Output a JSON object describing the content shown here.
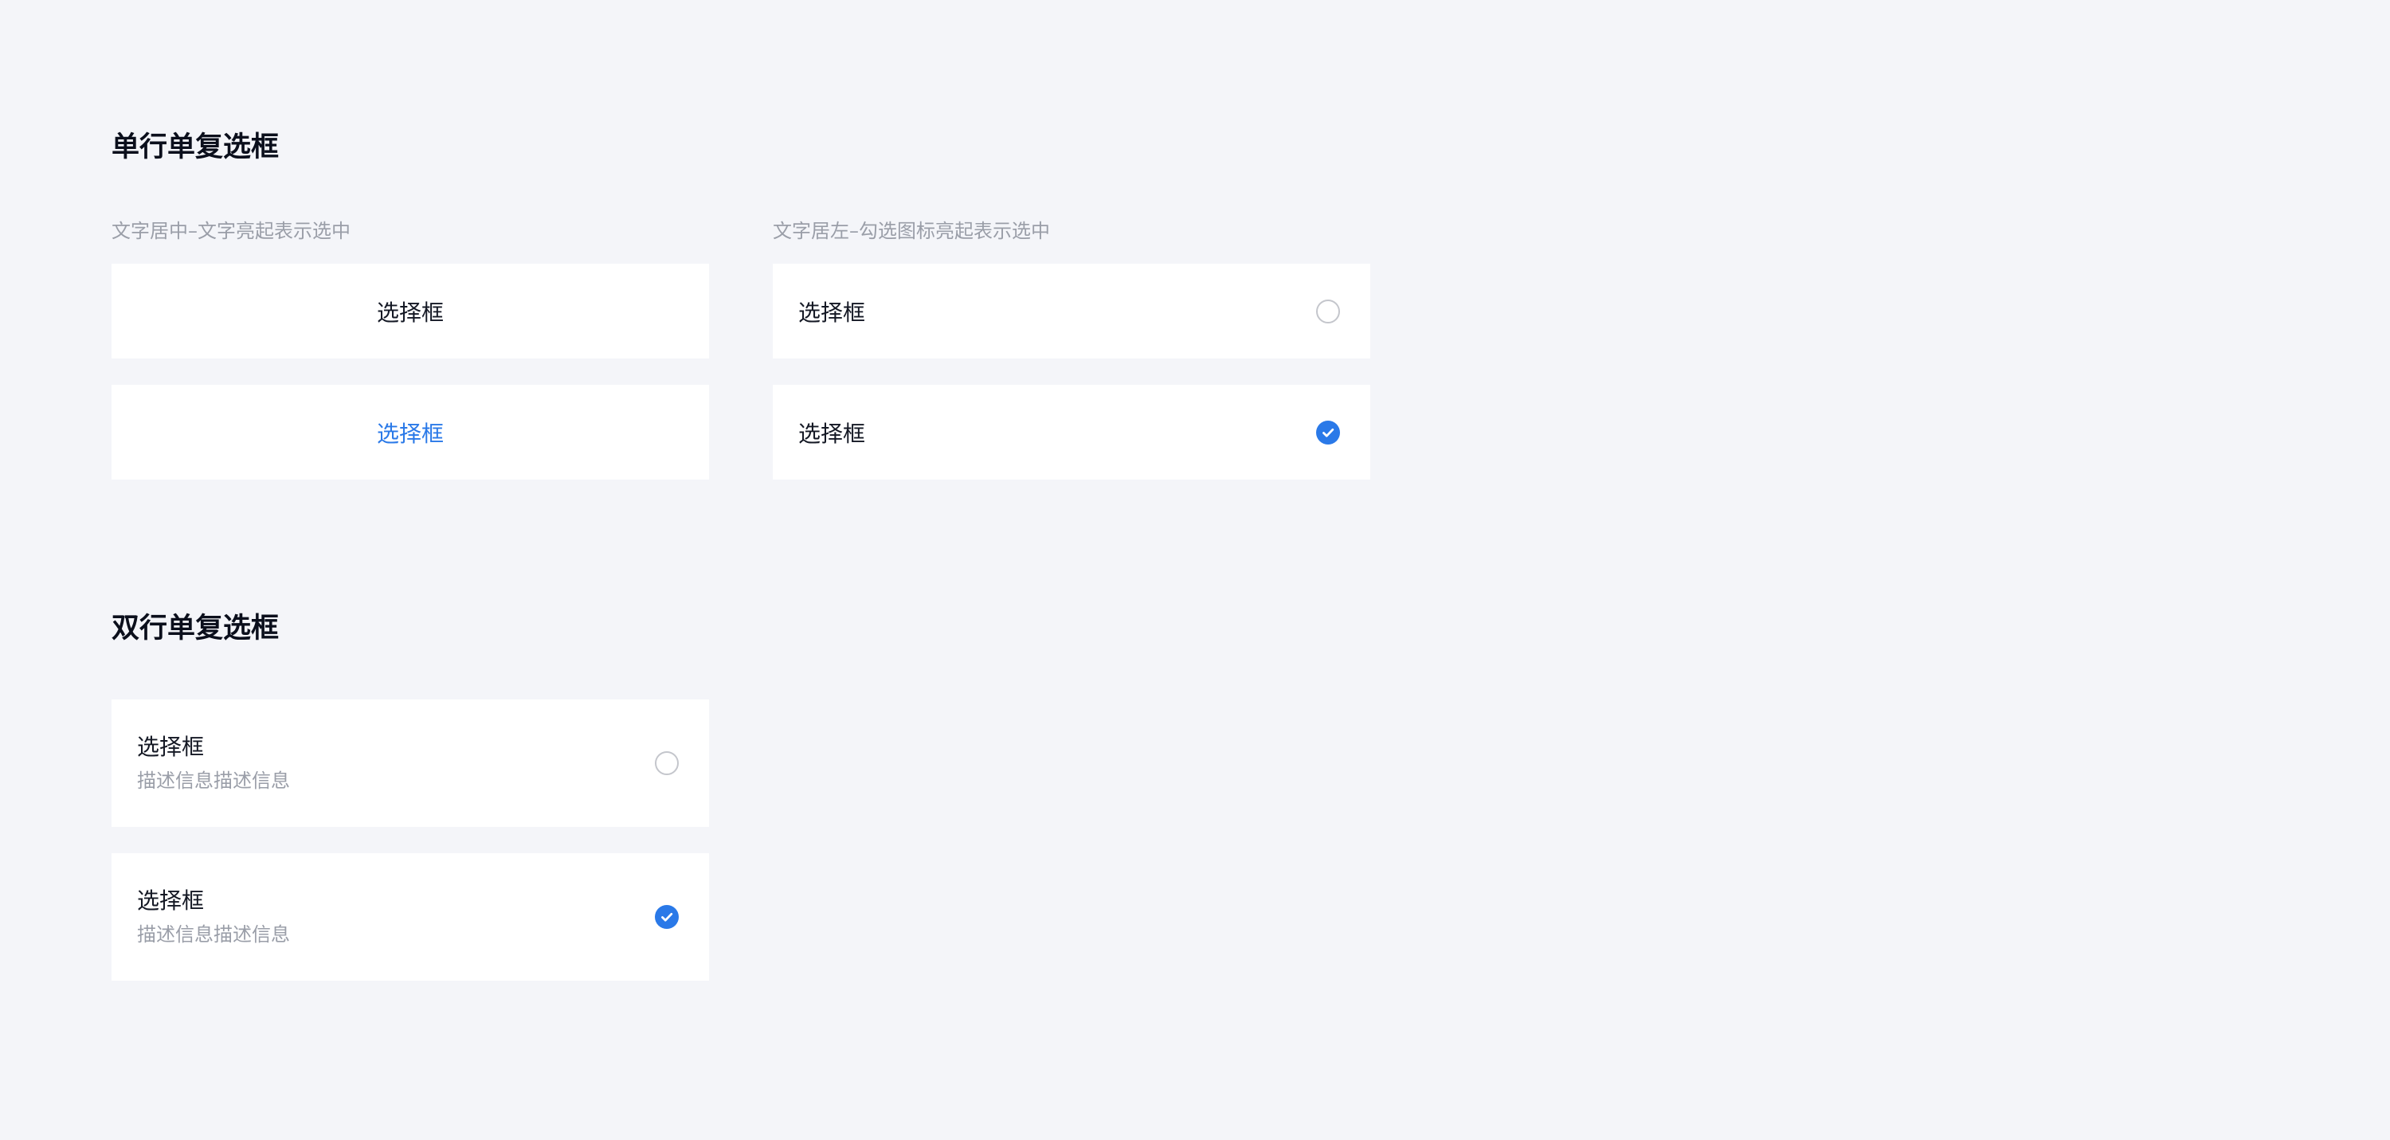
{
  "section1": {
    "title": "单行单复选框",
    "left": {
      "caption": "文字居中–文字亮起表示选中",
      "options": [
        {
          "label": "选择框",
          "selected": false
        },
        {
          "label": "选择框",
          "selected": true
        }
      ]
    },
    "right": {
      "caption": "文字居左–勾选图标亮起表示选中",
      "options": [
        {
          "label": "选择框",
          "selected": false
        },
        {
          "label": "选择框",
          "selected": true
        }
      ]
    }
  },
  "section2": {
    "title": "双行单复选框",
    "options": [
      {
        "label": "选择框",
        "description": "描述信息描述信息",
        "selected": false
      },
      {
        "label": "选择框",
        "description": "描述信息描述信息",
        "selected": true
      }
    ]
  },
  "colors": {
    "background": "#f4f5f9",
    "card": "#ffffff",
    "accent": "#2a79e8",
    "text_primary": "#141824",
    "text_secondary": "#9a9ea8",
    "radio_border": "#c4c6cc"
  },
  "icons": {
    "unchecked": "radio-unchecked-icon",
    "checked": "radio-checked-icon"
  }
}
